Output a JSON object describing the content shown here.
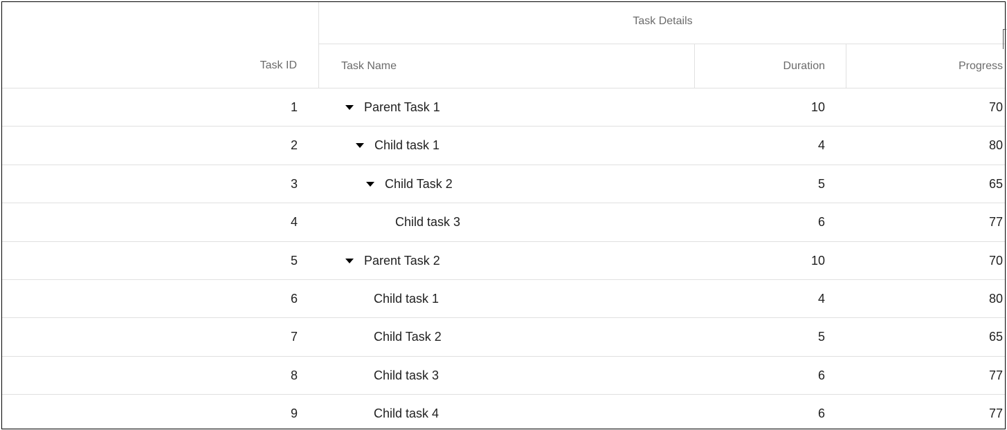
{
  "columns": {
    "task_id": "Task ID",
    "group": "Task Details",
    "task_name": "Task Name",
    "duration": "Duration",
    "progress": "Progress"
  },
  "rows": [
    {
      "id": "1",
      "name": "Parent Task 1",
      "duration": "10",
      "progress": "70",
      "level": 0,
      "expandable": true
    },
    {
      "id": "2",
      "name": "Child task 1",
      "duration": "4",
      "progress": "80",
      "level": 1,
      "expandable": true
    },
    {
      "id": "3",
      "name": "Child Task 2",
      "duration": "5",
      "progress": "65",
      "level": 2,
      "expandable": true
    },
    {
      "id": "4",
      "name": "Child task 3",
      "duration": "6",
      "progress": "77",
      "level": 3,
      "expandable": false
    },
    {
      "id": "5",
      "name": "Parent Task 2",
      "duration": "10",
      "progress": "70",
      "level": 0,
      "expandable": true
    },
    {
      "id": "6",
      "name": "Child task 1",
      "duration": "4",
      "progress": "80",
      "level": 1,
      "expandable": false
    },
    {
      "id": "7",
      "name": "Child Task 2",
      "duration": "5",
      "progress": "65",
      "level": 1,
      "expandable": false
    },
    {
      "id": "8",
      "name": "Child task 3",
      "duration": "6",
      "progress": "77",
      "level": 1,
      "expandable": false
    },
    {
      "id": "9",
      "name": "Child task 4",
      "duration": "6",
      "progress": "77",
      "level": 1,
      "expandable": false
    }
  ],
  "colors": {
    "border": "#e0e0e0",
    "header_text": "#6b6b6b",
    "cell_text": "#212121",
    "caret": "#000000"
  }
}
